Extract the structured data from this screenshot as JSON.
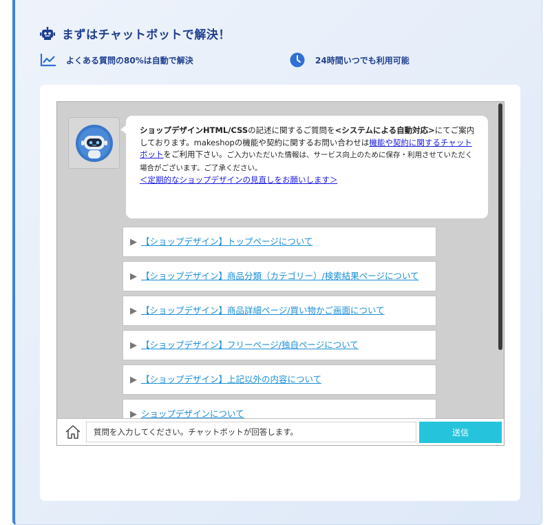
{
  "header": {
    "title": "まずはチャットボットで解決！",
    "robot_icon": "robot-icon"
  },
  "features": [
    {
      "icon": "chart-line-icon",
      "label": "よくある質問の80%は自動で解決"
    },
    {
      "icon": "clock-icon",
      "label": "24時間いつでも利用可能"
    }
  ],
  "chat": {
    "bot_avatar": "bot-avatar",
    "message": {
      "part1_bold": "ショップデザインHTML/CSS",
      "part2": "の記述に関するご質問を",
      "part3_bold": "<システムによる自動対応>",
      "part4": "にてご案内しております。makeshopの機能や契約に関するお問い合わせは",
      "link1": "機能や契約に関するチャットボット",
      "part5": "をご利用下さい。",
      "part6_small": "ご入力いただいた情報は、サービス向上のために保存・利用させていただく場合がございます。ご了承ください。",
      "link2": "＜定期的なショップデザインの見直しをお願いします＞"
    },
    "options": [
      "【ショップデザイン】トップページについて",
      "【ショップデザイン】商品分類（カテゴリー）/検索結果ページについて",
      "【ショップデザイン】商品詳細ページ/買い物かご画面について",
      "【ショップデザイン】フリーページ/独自ページについて",
      "【ショップデザイン】上記以外の内容について",
      "ショップデザインについて"
    ],
    "input_placeholder": "質問を入力してください。チャットボットが回答します。",
    "send_label": "送信",
    "home_icon": "home-icon"
  },
  "colors": {
    "accent": "#3b82e0",
    "title": "#1f3f8f",
    "send": "#26c4dc",
    "option_link": "#1b8fd6"
  }
}
